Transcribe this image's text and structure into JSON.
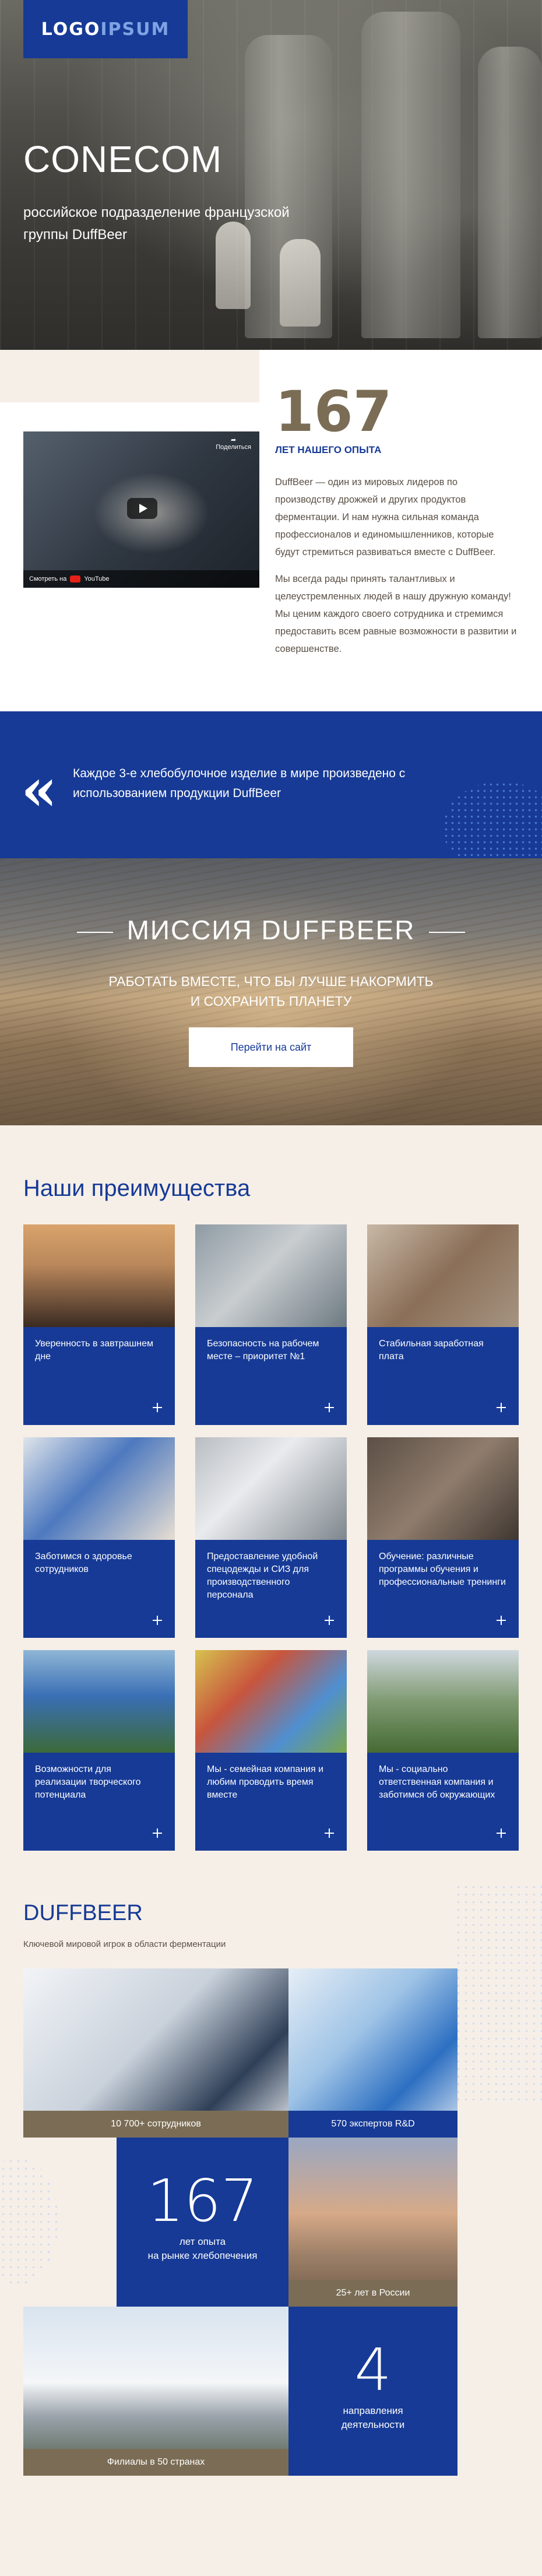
{
  "hero": {
    "logo_part1": "LOGO",
    "logo_part2": "IPSUM",
    "title": "CONECOM",
    "subtitle": "российское подразделение французской группы DuffBeer"
  },
  "about": {
    "video": {
      "share_label": "Поделиться",
      "watch_label": "Смотреть на",
      "platform": "YouTube"
    },
    "years": "167",
    "years_label": "ЛЕТ НАШЕГО ОПЫТА",
    "paragraph1": "DuffBeer — один из мировых лидеров по производству дрожжей и других продуктов ферментации. И нам нужна сильная команда профессионалов и единомышленников, которые будут стремиться развиваться вместе с DuffBeer.",
    "paragraph2": "Мы всегда рады принять талантливых и целеустремленных людей в нашу дружную команду! Мы ценим каждого своего сотрудника и стремимся предоставить всем равные возможности в развитии и совершенстве."
  },
  "quote": {
    "text": "Каждое 3-е хлебобулочное изделие в мире произведено с использованием продукции DuffBeer"
  },
  "mission": {
    "title": "МИССИЯ DUFFBEER",
    "line1": "РАБОТАТЬ ВМЕСТЕ, ЧТО БЫ ЛУЧШЕ НАКОРМИТЬ",
    "line2": "И СОХРАНИТЬ ПЛАНЕТУ",
    "button": "Перейти на сайт"
  },
  "advantages": {
    "title": "Наши преимущества",
    "cards": [
      {
        "label": "Уверенность в завтрашнем дне"
      },
      {
        "label": "Безопасность на рабочем месте – приоритет №1"
      },
      {
        "label": "Стабильная заработная плата"
      },
      {
        "label": "Заботимся о здоровье сотрудников"
      },
      {
        "label": "Предоставление удобной спецодежды и СИЗ для производственного персонала"
      },
      {
        "label": "Обучение: различные программы обучения и профессиональные тренинги"
      },
      {
        "label": "Возможности для реализации творческого потенциала"
      },
      {
        "label": "Мы - семейная компания и любим проводить время вместе"
      },
      {
        "label": "Мы - социально ответственная компания и заботимся об окружающих"
      }
    ]
  },
  "duffbeer": {
    "title": "DUFFBEER",
    "subtitle": "Ключевой мировой игрок в области ферментации",
    "employees": "10 700+ сотрудников",
    "experts": "570 экспертов R&D",
    "years_number": "167",
    "years_text1": "лет опыта",
    "years_text2": "на рынке хлебопечения",
    "russia": "25+ лет в России",
    "branches": "Филиалы в 50 странах",
    "directions_number": "4",
    "directions_text1": "направления",
    "directions_text2": "деятельности"
  }
}
